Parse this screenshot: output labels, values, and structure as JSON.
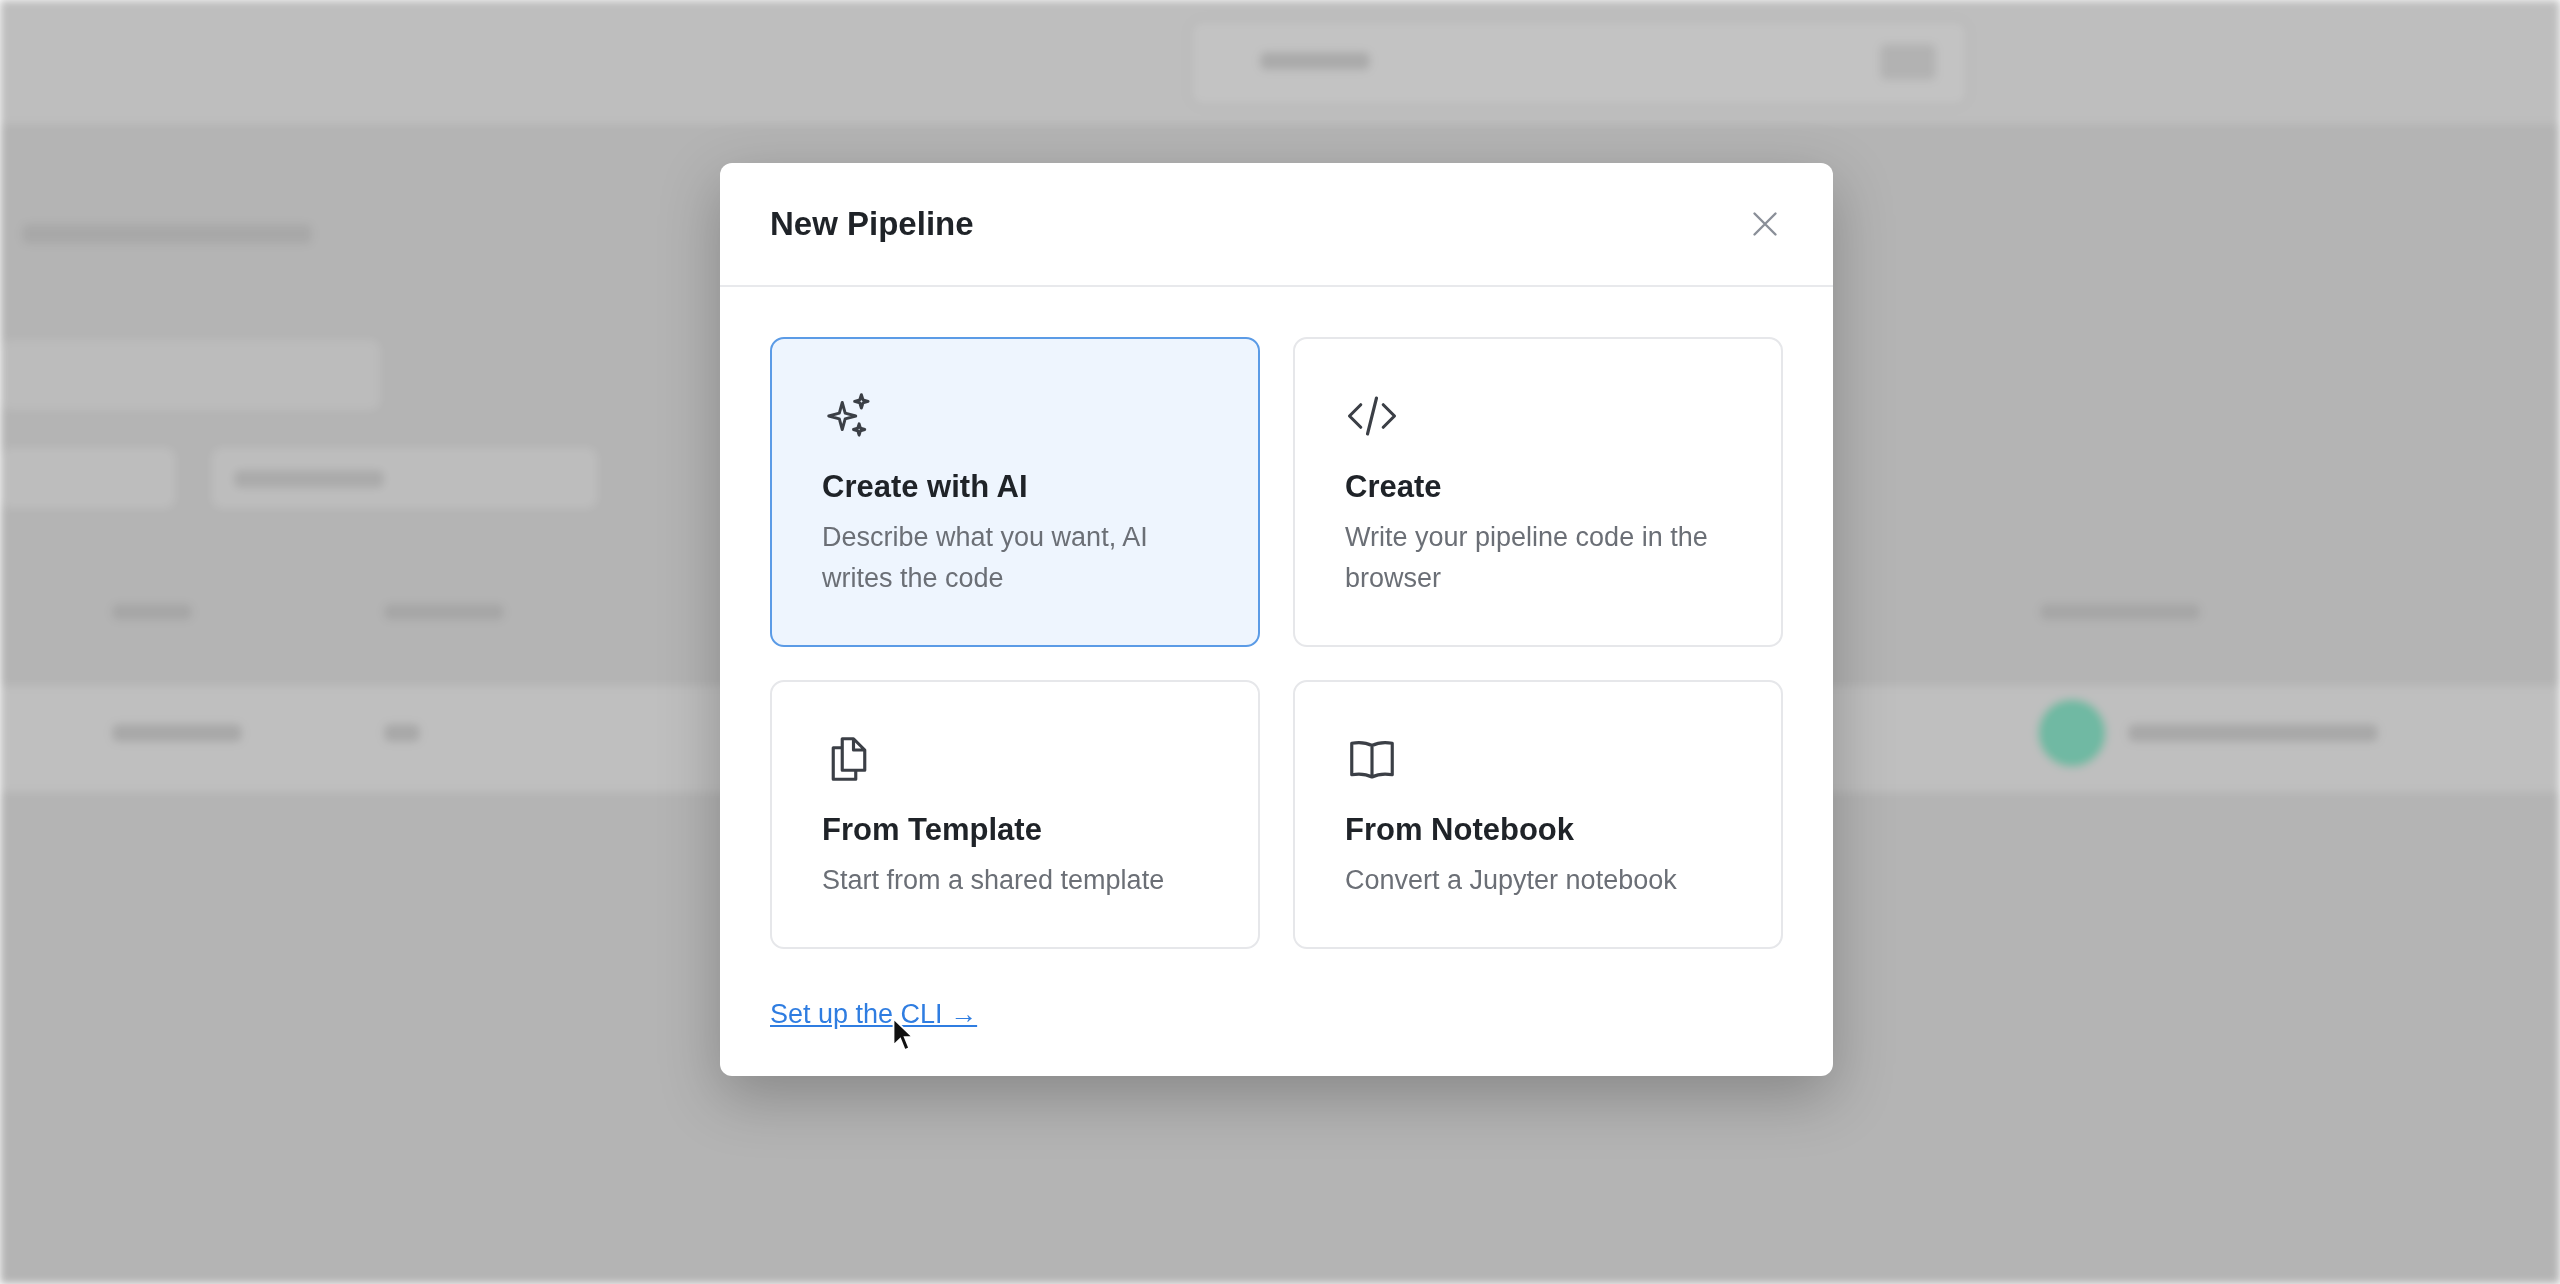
{
  "dialog": {
    "title": "New Pipeline",
    "options": [
      {
        "kind": "ai",
        "title": "Create with AI",
        "description": "Describe what you want, AI writes the code",
        "selected": true
      },
      {
        "kind": "code",
        "title": "Create",
        "description": "Write your pipeline code in the browser",
        "selected": false
      },
      {
        "kind": "template",
        "title": "From Template",
        "description": "Start from a shared template",
        "selected": false
      },
      {
        "kind": "notebook",
        "title": "From Notebook",
        "description": "Convert a Jupyter notebook",
        "selected": false
      }
    ],
    "link": "Set up the CLI →"
  }
}
